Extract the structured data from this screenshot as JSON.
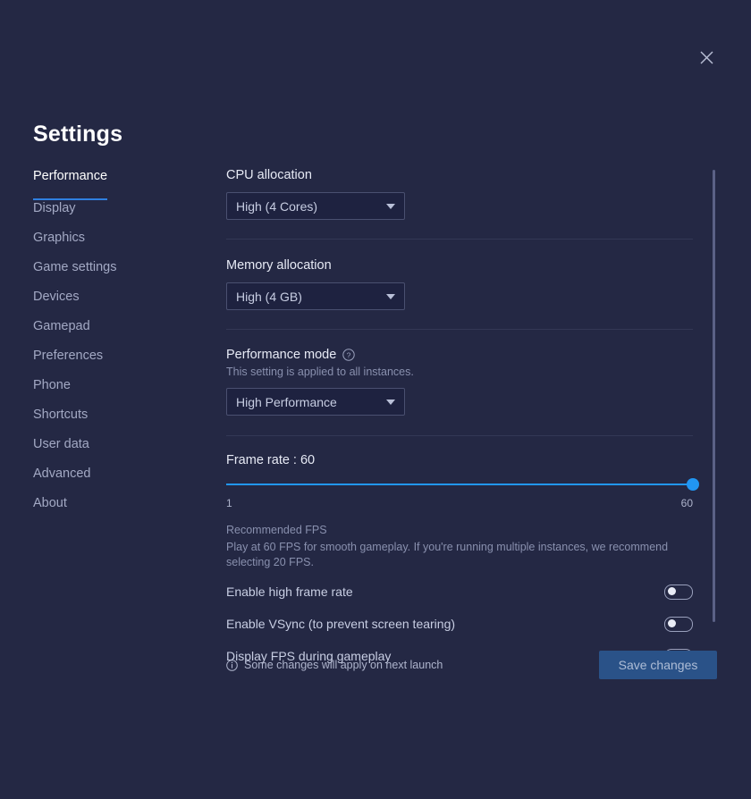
{
  "window": {
    "title": "Settings",
    "close_icon": "close-icon"
  },
  "sidebar": {
    "items": [
      {
        "label": "Performance",
        "active": true
      },
      {
        "label": "Display",
        "active": false
      },
      {
        "label": "Graphics",
        "active": false
      },
      {
        "label": "Game settings",
        "active": false
      },
      {
        "label": "Devices",
        "active": false
      },
      {
        "label": "Gamepad",
        "active": false
      },
      {
        "label": "Preferences",
        "active": false
      },
      {
        "label": "Phone",
        "active": false
      },
      {
        "label": "Shortcuts",
        "active": false
      },
      {
        "label": "User data",
        "active": false
      },
      {
        "label": "Advanced",
        "active": false
      },
      {
        "label": "About",
        "active": false
      }
    ]
  },
  "content": {
    "cpu": {
      "label": "CPU allocation",
      "value": "High (4 Cores)"
    },
    "memory": {
      "label": "Memory allocation",
      "value": "High (4 GB)"
    },
    "performance_mode": {
      "label": "Performance mode",
      "help_icon": "question-mark-circle-icon",
      "subtitle": "This setting is applied to all instances.",
      "value": "High Performance"
    },
    "frame_rate": {
      "label": "Frame rate : 60",
      "value": 60,
      "min": 1,
      "max": 60,
      "min_label": "1",
      "max_label": "60",
      "accent_color": "#2196f3"
    },
    "recommendation": {
      "title": "Recommended FPS",
      "description": "Play at 60 FPS for smooth gameplay. If you're running multiple instances, we recommend selecting 20 FPS."
    },
    "toggles": [
      {
        "label": "Enable high frame rate",
        "on": false
      },
      {
        "label": "Enable VSync (to prevent screen tearing)",
        "on": false
      },
      {
        "label": "Display FPS during gameplay",
        "on": false
      }
    ]
  },
  "footer": {
    "info_icon": "info-circle-icon",
    "note": "Some changes will apply on next launch",
    "save_label": "Save changes"
  }
}
